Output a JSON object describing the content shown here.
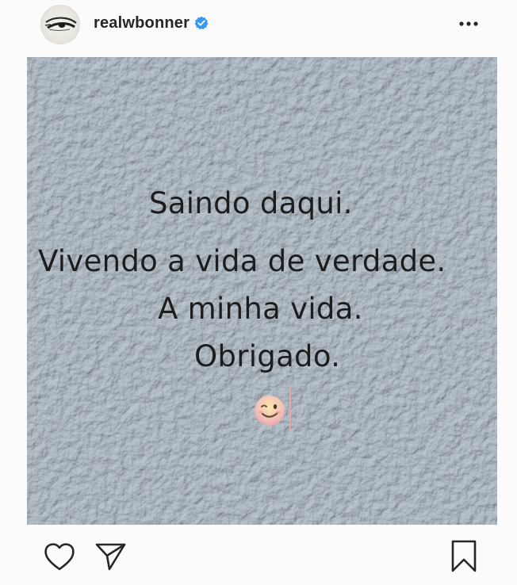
{
  "header": {
    "username": "realwbonner",
    "verified": true,
    "avatar_icon": "eye-icon",
    "more_icon": "more-horizontal-icon"
  },
  "post": {
    "lines": [
      "Saindo daqui.",
      "Vivendo a vida de verdade.",
      "A minha vida.",
      "Obrigado."
    ],
    "emoji": "😉",
    "emoji_name": "winking-face-emoji",
    "background_color": "#c5ccd2"
  },
  "actions": {
    "like_icon": "heart-icon",
    "share_icon": "paper-plane-icon",
    "save_icon": "bookmark-icon"
  },
  "colors": {
    "verified_badge": "#3897f0",
    "text": "#262626"
  }
}
